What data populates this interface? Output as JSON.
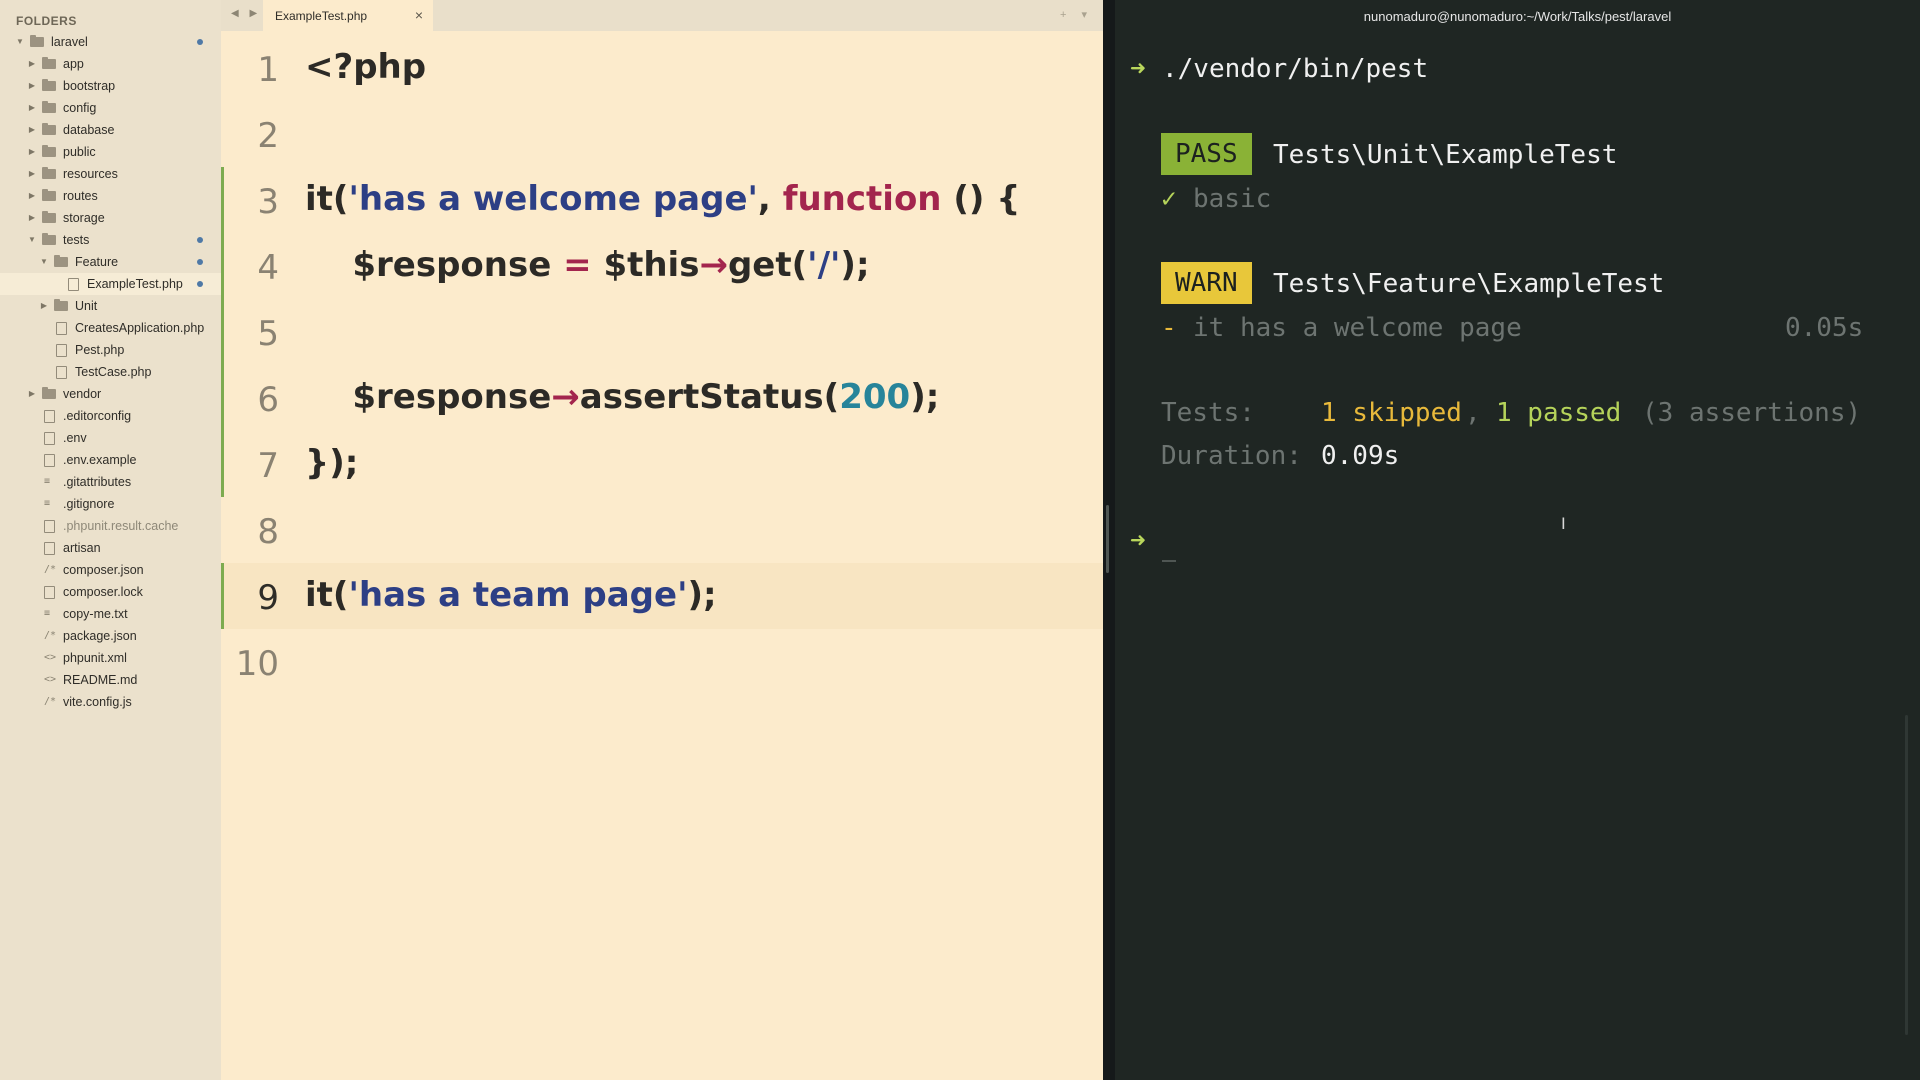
{
  "sidebar": {
    "title": "FOLDERS",
    "items": [
      {
        "label": "laravel",
        "depth": 0,
        "type": "folder",
        "open": true,
        "dot": true
      },
      {
        "label": "app",
        "depth": 1,
        "type": "folder"
      },
      {
        "label": "bootstrap",
        "depth": 1,
        "type": "folder"
      },
      {
        "label": "config",
        "depth": 1,
        "type": "folder"
      },
      {
        "label": "database",
        "depth": 1,
        "type": "folder"
      },
      {
        "label": "public",
        "depth": 1,
        "type": "folder"
      },
      {
        "label": "resources",
        "depth": 1,
        "type": "folder"
      },
      {
        "label": "routes",
        "depth": 1,
        "type": "folder"
      },
      {
        "label": "storage",
        "depth": 1,
        "type": "folder"
      },
      {
        "label": "tests",
        "depth": 1,
        "type": "folder",
        "open": true,
        "dot": true
      },
      {
        "label": "Feature",
        "depth": 2,
        "type": "folder",
        "open": true,
        "dot": true
      },
      {
        "label": "ExampleTest.php",
        "depth": 3,
        "type": "file",
        "selected": true,
        "dot": true
      },
      {
        "label": "Unit",
        "depth": 2,
        "type": "folder"
      },
      {
        "label": "CreatesApplication.php",
        "depth": 2,
        "type": "file"
      },
      {
        "label": "Pest.php",
        "depth": 2,
        "type": "file"
      },
      {
        "label": "TestCase.php",
        "depth": 2,
        "type": "file"
      },
      {
        "label": "vendor",
        "depth": 1,
        "type": "folder"
      },
      {
        "label": ".editorconfig",
        "depth": 1,
        "type": "file"
      },
      {
        "label": ".env",
        "depth": 1,
        "type": "file"
      },
      {
        "label": ".env.example",
        "depth": 1,
        "type": "file"
      },
      {
        "label": ".gitattributes",
        "depth": 1,
        "type": "lines"
      },
      {
        "label": ".gitignore",
        "depth": 1,
        "type": "lines"
      },
      {
        "label": ".phpunit.result.cache",
        "depth": 1,
        "type": "file",
        "dim": true
      },
      {
        "label": "artisan",
        "depth": 1,
        "type": "file"
      },
      {
        "label": "composer.json",
        "depth": 1,
        "type": "slash"
      },
      {
        "label": "composer.lock",
        "depth": 1,
        "type": "file"
      },
      {
        "label": "copy-me.txt",
        "depth": 1,
        "type": "lines"
      },
      {
        "label": "package.json",
        "depth": 1,
        "type": "slash"
      },
      {
        "label": "phpunit.xml",
        "depth": 1,
        "type": "code"
      },
      {
        "label": "README.md",
        "depth": 1,
        "type": "code"
      },
      {
        "label": "vite.config.js",
        "depth": 1,
        "type": "slash"
      }
    ]
  },
  "editor": {
    "tab": {
      "label": "ExampleTest.php",
      "close": "×"
    },
    "nav": "◀ ▶",
    "tools": "+ ▾",
    "active_line": 9,
    "modified_lines": [
      3,
      4,
      5,
      6,
      7,
      9
    ],
    "lines": [
      {
        "n": "1",
        "tokens": [
          {
            "t": "<?php",
            "c": "plain"
          }
        ]
      },
      {
        "n": "2",
        "tokens": []
      },
      {
        "n": "3",
        "tokens": [
          {
            "t": "it(",
            "c": "plain"
          },
          {
            "t": "'has a welcome page'",
            "c": "str"
          },
          {
            "t": ", ",
            "c": "plain"
          },
          {
            "t": "function",
            "c": "kw"
          },
          {
            "t": " () {",
            "c": "plain"
          }
        ]
      },
      {
        "n": "4",
        "tokens": [
          {
            "t": "    $response ",
            "c": "var"
          },
          {
            "t": "=",
            "c": "op"
          },
          {
            "t": " $this",
            "c": "var"
          },
          {
            "t": "→",
            "c": "op"
          },
          {
            "t": "get(",
            "c": "plain"
          },
          {
            "t": "'/'",
            "c": "str"
          },
          {
            "t": ");",
            "c": "plain"
          }
        ]
      },
      {
        "n": "5",
        "tokens": []
      },
      {
        "n": "6",
        "tokens": [
          {
            "t": "    $response",
            "c": "var"
          },
          {
            "t": "→",
            "c": "op"
          },
          {
            "t": "assertStatus(",
            "c": "plain"
          },
          {
            "t": "200",
            "c": "num"
          },
          {
            "t": ");",
            "c": "plain"
          }
        ]
      },
      {
        "n": "7",
        "tokens": [
          {
            "t": "});",
            "c": "plain"
          }
        ]
      },
      {
        "n": "8",
        "tokens": []
      },
      {
        "n": "9",
        "tokens": [
          {
            "t": "it(",
            "c": "plain"
          },
          {
            "t": "'has a team page'",
            "c": "str"
          },
          {
            "t": ");",
            "c": "plain"
          }
        ]
      },
      {
        "n": "10",
        "tokens": []
      }
    ]
  },
  "terminal": {
    "title": "nunomaduro@nunomaduro:~/Work/Talks/pest/laravel",
    "prompt": "➜",
    "command": "./vendor/bin/pest",
    "pass_badge": "PASS",
    "pass_suite": "Tests\\Unit\\ExampleTest",
    "check": "✓",
    "pass_test": "basic",
    "warn_badge": "WARN",
    "warn_suite": "Tests\\Feature\\ExampleTest",
    "dash": "-",
    "warn_test": "it has a welcome page",
    "warn_time": "0.05s",
    "tests_label": "Tests:",
    "skipped": "1 skipped",
    "comma": ",",
    "passed": "1 passed",
    "assertions": "(3 assertions)",
    "duration_label": "Duration:",
    "duration_value": "0.09s",
    "ibeam": "I"
  },
  "colors": {
    "editor_bg": "#fcebcc",
    "sidebar_bg": "#ebe1cc",
    "terminal_bg": "#1f2623",
    "pass": "#8ab236",
    "warn": "#e8c73a",
    "string": "#2d3f85",
    "keyword": "#a3254d",
    "number": "#27849a"
  }
}
